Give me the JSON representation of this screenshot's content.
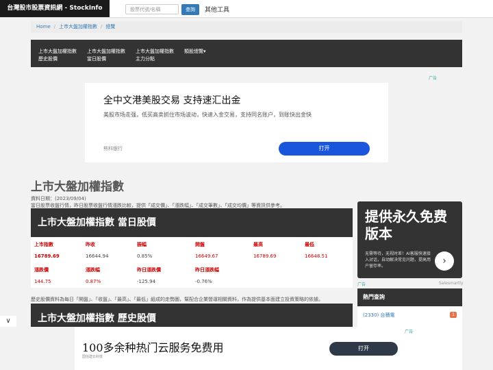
{
  "header": {
    "brand": "台灣股市股票資訊網 - StockInfo",
    "search_placeholder": "股票代號/名稱",
    "search_button": "查詢",
    "tools": "其他工具"
  },
  "breadcrumb": [
    "Home",
    "上市大盤加權指數",
    "總覽"
  ],
  "nav": [
    {
      "line1": "上市大盤加權指數",
      "line2": "歷史股價"
    },
    {
      "line1": "上市大盤加權指數",
      "line2": "當日股價"
    },
    {
      "line1": "上市大盤加權指數",
      "line2": "主力分點"
    },
    {
      "line1": "類股總覽",
      "line2": ""
    }
  ],
  "ad_top": {
    "title": "全中文港美股交易 支持速汇出金",
    "subtitle": "美股市场走强，低买高卖抓住市场波动，快速入金交易，支持同名账户，到账快出金快",
    "brand": "熊科银行",
    "button": "打开",
    "adchoice": "广告"
  },
  "page": {
    "title": "上市大盤加權指數",
    "date": "資料日期：(2023/09/04)",
    "desc": "當日股票收盤行情，昨日股票收盤行情漲跌比較，提供「成交價」、「漲跌幅」、「成交筆數」、「成交均價」等資訊供參考。",
    "panel1_title": "上市大盤加權指數 當日股價",
    "history_desc": "歷史股價資料為每日「開盤」、「收盤」、「最高」、「最低」組成的走勢圖，幫配合企業營運相關資料，作為提供基本面建立投資策略的依據。",
    "panel2_title": "上市大盤加權指數 歷史股價"
  },
  "quote": {
    "row1_headers": [
      "上市指數",
      "昨收",
      "振幅",
      "開盤",
      "最高",
      "最低"
    ],
    "row1_values": [
      "16789.69",
      "16644.94",
      "0.85%",
      "16649.67",
      "16789.69",
      "16648.51"
    ],
    "row2_headers": [
      "漲跌價",
      "漲跌幅",
      "昨日漲跌價",
      "昨日漲跌幅"
    ],
    "row2_values": [
      "144.75",
      "0.87%",
      "-125.94",
      "-0.76%"
    ]
  },
  "right_ad": {
    "big": "提供永久免费版本",
    "small": "无需等待，无视时差！AI客服快速接入对话，自动解决常见问题，提高用户留存率。",
    "arrow": "›",
    "adchoice": "广告",
    "sponsor": "Salesmartly"
  },
  "hot": {
    "title": "熱門查詢",
    "item": "(2330) 台積電",
    "badge": "1"
  },
  "bottom_ad": {
    "title": "100多余种热门云服务免费用",
    "brand": "国信建云科技",
    "button": "打开",
    "adchoice": "广告"
  },
  "chevron": "∨"
}
